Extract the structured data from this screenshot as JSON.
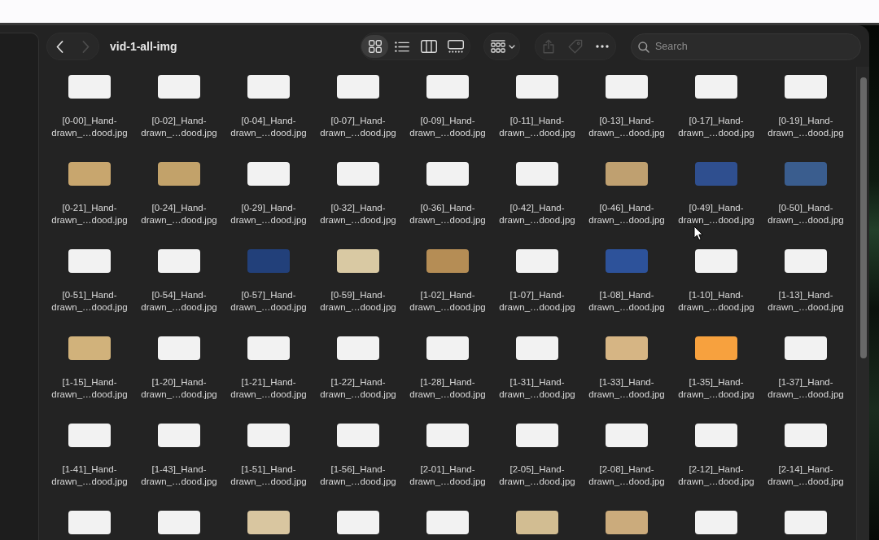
{
  "window": {
    "title": "vid-1-all-img"
  },
  "toolbar": {
    "nav_buttons": [
      {
        "kind": "back",
        "disabled": false
      },
      {
        "kind": "forward",
        "disabled": true
      }
    ],
    "view_modes": [
      {
        "kind": "icons",
        "selected": true
      },
      {
        "kind": "list",
        "selected": false
      },
      {
        "kind": "columns",
        "selected": false
      },
      {
        "kind": "gallery",
        "selected": false
      }
    ],
    "actions": [
      {
        "kind": "share",
        "disabled": true
      },
      {
        "kind": "tag",
        "disabled": true
      },
      {
        "kind": "more",
        "disabled": false
      }
    ],
    "search": {
      "placeholder": "Search"
    }
  },
  "files": [
    {
      "name": "[0-00]_Hand-drawn_…dood.jpg",
      "color": "#f2f2f2"
    },
    {
      "name": "[0-02]_Hand-drawn_…dood.jpg",
      "color": "#f2f2f2"
    },
    {
      "name": "[0-04]_Hand-drawn_…dood.jpg",
      "color": "#f2f2f2"
    },
    {
      "name": "[0-07]_Hand-drawn_…dood.jpg",
      "color": "#f2f2f2"
    },
    {
      "name": "[0-09]_Hand-drawn_…dood.jpg",
      "color": "#f2f2f2"
    },
    {
      "name": "[0-11]_Hand-drawn_…dood.jpg",
      "color": "#f2f2f2"
    },
    {
      "name": "[0-13]_Hand-drawn_…dood.jpg",
      "color": "#f2f2f2"
    },
    {
      "name": "[0-17]_Hand-drawn_…dood.jpg",
      "color": "#f2f2f2"
    },
    {
      "name": "[0-19]_Hand-drawn_…dood.jpg",
      "color": "#f2f2f2"
    },
    {
      "name": "[0-21]_Hand-drawn_…dood.jpg",
      "color": "#c8a66e"
    },
    {
      "name": "[0-24]_Hand-drawn_…dood.jpg",
      "color": "#c2a26a"
    },
    {
      "name": "[0-29]_Hand-drawn_…dood.jpg",
      "color": "#f2f2f2"
    },
    {
      "name": "[0-32]_Hand-drawn_…dood.jpg",
      "color": "#f2f2f2"
    },
    {
      "name": "[0-36]_Hand-drawn_…dood.jpg",
      "color": "#f2f2f2"
    },
    {
      "name": "[0-42]_Hand-drawn_…dood.jpg",
      "color": "#f2f2f2"
    },
    {
      "name": "[0-46]_Hand-drawn_…dood.jpg",
      "color": "#bfa070"
    },
    {
      "name": "[0-49]_Hand-drawn_…dood.jpg",
      "color": "#2f4f8f"
    },
    {
      "name": "[0-50]_Hand-drawn_…dood.jpg",
      "color": "#3a5d8e"
    },
    {
      "name": "[0-51]_Hand-drawn_…dood.jpg",
      "color": "#f2f2f2"
    },
    {
      "name": "[0-54]_Hand-drawn_…dood.jpg",
      "color": "#f2f2f2"
    },
    {
      "name": "[0-57]_Hand-drawn_…dood.jpg",
      "color": "#22407a"
    },
    {
      "name": "[0-59]_Hand-drawn_…dood.jpg",
      "color": "#d9c9a3"
    },
    {
      "name": "[1-02]_Hand-drawn_…dood.jpg",
      "color": "#b58d55"
    },
    {
      "name": "[1-07]_Hand-drawn_…dood.jpg",
      "color": "#f2f2f2"
    },
    {
      "name": "[1-08]_Hand-drawn_…dood.jpg",
      "color": "#2d529a"
    },
    {
      "name": "[1-10]_Hand-drawn_…dood.jpg",
      "color": "#f2f2f2"
    },
    {
      "name": "[1-13]_Hand-drawn_…dood.jpg",
      "color": "#f2f2f2"
    },
    {
      "name": "[1-15]_Hand-drawn_…dood.jpg",
      "color": "#d1b27b"
    },
    {
      "name": "[1-20]_Hand-drawn_…dood.jpg",
      "color": "#f2f2f2"
    },
    {
      "name": "[1-21]_Hand-drawn_…dood.jpg",
      "color": "#f2f2f2"
    },
    {
      "name": "[1-22]_Hand-drawn_…dood.jpg",
      "color": "#f2f2f2"
    },
    {
      "name": "[1-28]_Hand-drawn_…dood.jpg",
      "color": "#f2f2f2"
    },
    {
      "name": "[1-31]_Hand-drawn_…dood.jpg",
      "color": "#f2f2f2"
    },
    {
      "name": "[1-33]_Hand-drawn_…dood.jpg",
      "color": "#d6b584"
    },
    {
      "name": "[1-35]_Hand-drawn_…dood.jpg",
      "color": "#f7a13e"
    },
    {
      "name": "[1-37]_Hand-drawn_…dood.jpg",
      "color": "#f2f2f2"
    },
    {
      "name": "[1-41]_Hand-drawn_…dood.jpg",
      "color": "#f2f2f2"
    },
    {
      "name": "[1-43]_Hand-drawn_…dood.jpg",
      "color": "#f2f2f2"
    },
    {
      "name": "[1-51]_Hand-drawn_…dood.jpg",
      "color": "#f2f2f2"
    },
    {
      "name": "[1-56]_Hand-drawn_…dood.jpg",
      "color": "#f2f2f2"
    },
    {
      "name": "[2-01]_Hand-drawn_…dood.jpg",
      "color": "#f2f2f2"
    },
    {
      "name": "[2-05]_Hand-drawn_…dood.jpg",
      "color": "#f2f2f2"
    },
    {
      "name": "[2-08]_Hand-drawn_…dood.jpg",
      "color": "#f2f2f2"
    },
    {
      "name": "[2-12]_Hand-drawn_…dood.jpg",
      "color": "#f2f2f2"
    },
    {
      "name": "[2-14]_Hand-drawn_…dood.jpg",
      "color": "#f2f2f2"
    },
    {
      "color": "#f2f2f2"
    },
    {
      "color": "#f2f2f2"
    },
    {
      "color": "#d9c6a0"
    },
    {
      "color": "#f2f2f2"
    },
    {
      "color": "#f2f2f2"
    },
    {
      "color": "#d2bd92"
    },
    {
      "color": "#cbab7c"
    },
    {
      "color": "#f2f2f2"
    },
    {
      "color": "#f2f2f2"
    }
  ]
}
